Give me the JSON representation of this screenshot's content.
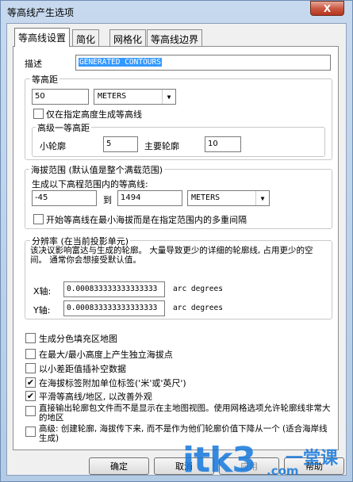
{
  "window": {
    "title": "等高线产生选项",
    "close_glyph": "X"
  },
  "tabs": [
    {
      "label": "等高线设置"
    },
    {
      "label": "简化"
    },
    {
      "label": "网格化"
    },
    {
      "label": "等高线边界"
    }
  ],
  "description": {
    "label": "描述",
    "value": "GENERATED CONTOURS"
  },
  "interval": {
    "title": "等高距",
    "value": "50",
    "unit": "METERS",
    "only_specified_checkbox": "仅在指定高度生成等高线",
    "only_specified_checked": false,
    "levels": {
      "title": "高级一等高距",
      "minor_label": "小轮廓",
      "minor_value": "5",
      "major_label": "主要轮廓",
      "major_value": "10"
    }
  },
  "elevation_range": {
    "title": "海拔范围 (默认值是整个满载范围)",
    "subtitle": "生成以下高程范围内的等高线:",
    "min_value": "-45",
    "to_label": "到",
    "max_value": "1494",
    "unit": "METERS",
    "multiple_interval_checkbox": "开始等高线在最小海拔而是在指定范围内的多重间隔",
    "multiple_interval_checked": false
  },
  "resolution": {
    "title": "分辨率 (在当前投影单元)",
    "description": "该决议影响富达与生成的轮廓。 大量导致更少的详细的轮廓线, 占用更少的空间。 通常你会想接受默认值。",
    "x_label": "X轴:",
    "x_value": "0.000833333333333333",
    "x_unit": "arc degrees",
    "y_label": "Y轴:",
    "y_value": "0.000833333333333333",
    "y_unit": "arc degrees"
  },
  "options": [
    {
      "label": "生成分色填充区地图",
      "checked": false
    },
    {
      "label": "在最大/最小高度上产生独立海拔点",
      "checked": false
    },
    {
      "label": "以小差距值插补空数据",
      "checked": false
    },
    {
      "label": "在海拔标签附加单位标签('米'或'英尺')",
      "checked": true
    },
    {
      "label": "平滑等高线/地区, 以改善外观",
      "checked": true
    },
    {
      "label": "直接输出轮廓包文件而不是显示在主地图视图。使用网格选项允许轮廓线非常大的地区",
      "checked": false
    },
    {
      "label": "高级: 创建轮廓, 海拔传下来, 而不是作为他们轮廓价值下降从一个 (适合海岸线生成)",
      "checked": false
    }
  ],
  "buttons": {
    "ok": "确定",
    "cancel": "取消",
    "apply": "应用",
    "help": "帮助"
  },
  "checkmark_glyph": "✔",
  "dropdown_glyph": "▼",
  "watermark": {
    "logo": "itk3",
    "domain": ".com",
    "slogan": "一堂课"
  }
}
